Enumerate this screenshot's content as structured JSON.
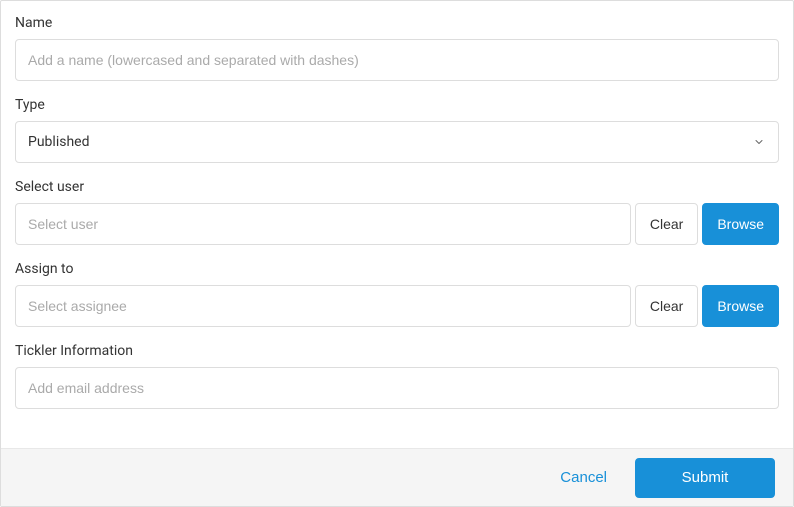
{
  "fields": {
    "name": {
      "label": "Name",
      "placeholder": "Add a name (lowercased and separated with dashes)",
      "value": ""
    },
    "type": {
      "label": "Type",
      "selected": "Published"
    },
    "selectUser": {
      "label": "Select user",
      "placeholder": "Select user",
      "value": "",
      "clearLabel": "Clear",
      "browseLabel": "Browse"
    },
    "assignTo": {
      "label": "Assign to",
      "placeholder": "Select assignee",
      "value": "",
      "clearLabel": "Clear",
      "browseLabel": "Browse"
    },
    "ticklerInfo": {
      "label": "Tickler Information",
      "placeholder": "Add email address",
      "value": ""
    }
  },
  "footer": {
    "cancelLabel": "Cancel",
    "submitLabel": "Submit"
  },
  "colors": {
    "primary": "#1890d8",
    "border": "#ddd",
    "footerBg": "#f5f5f5"
  }
}
